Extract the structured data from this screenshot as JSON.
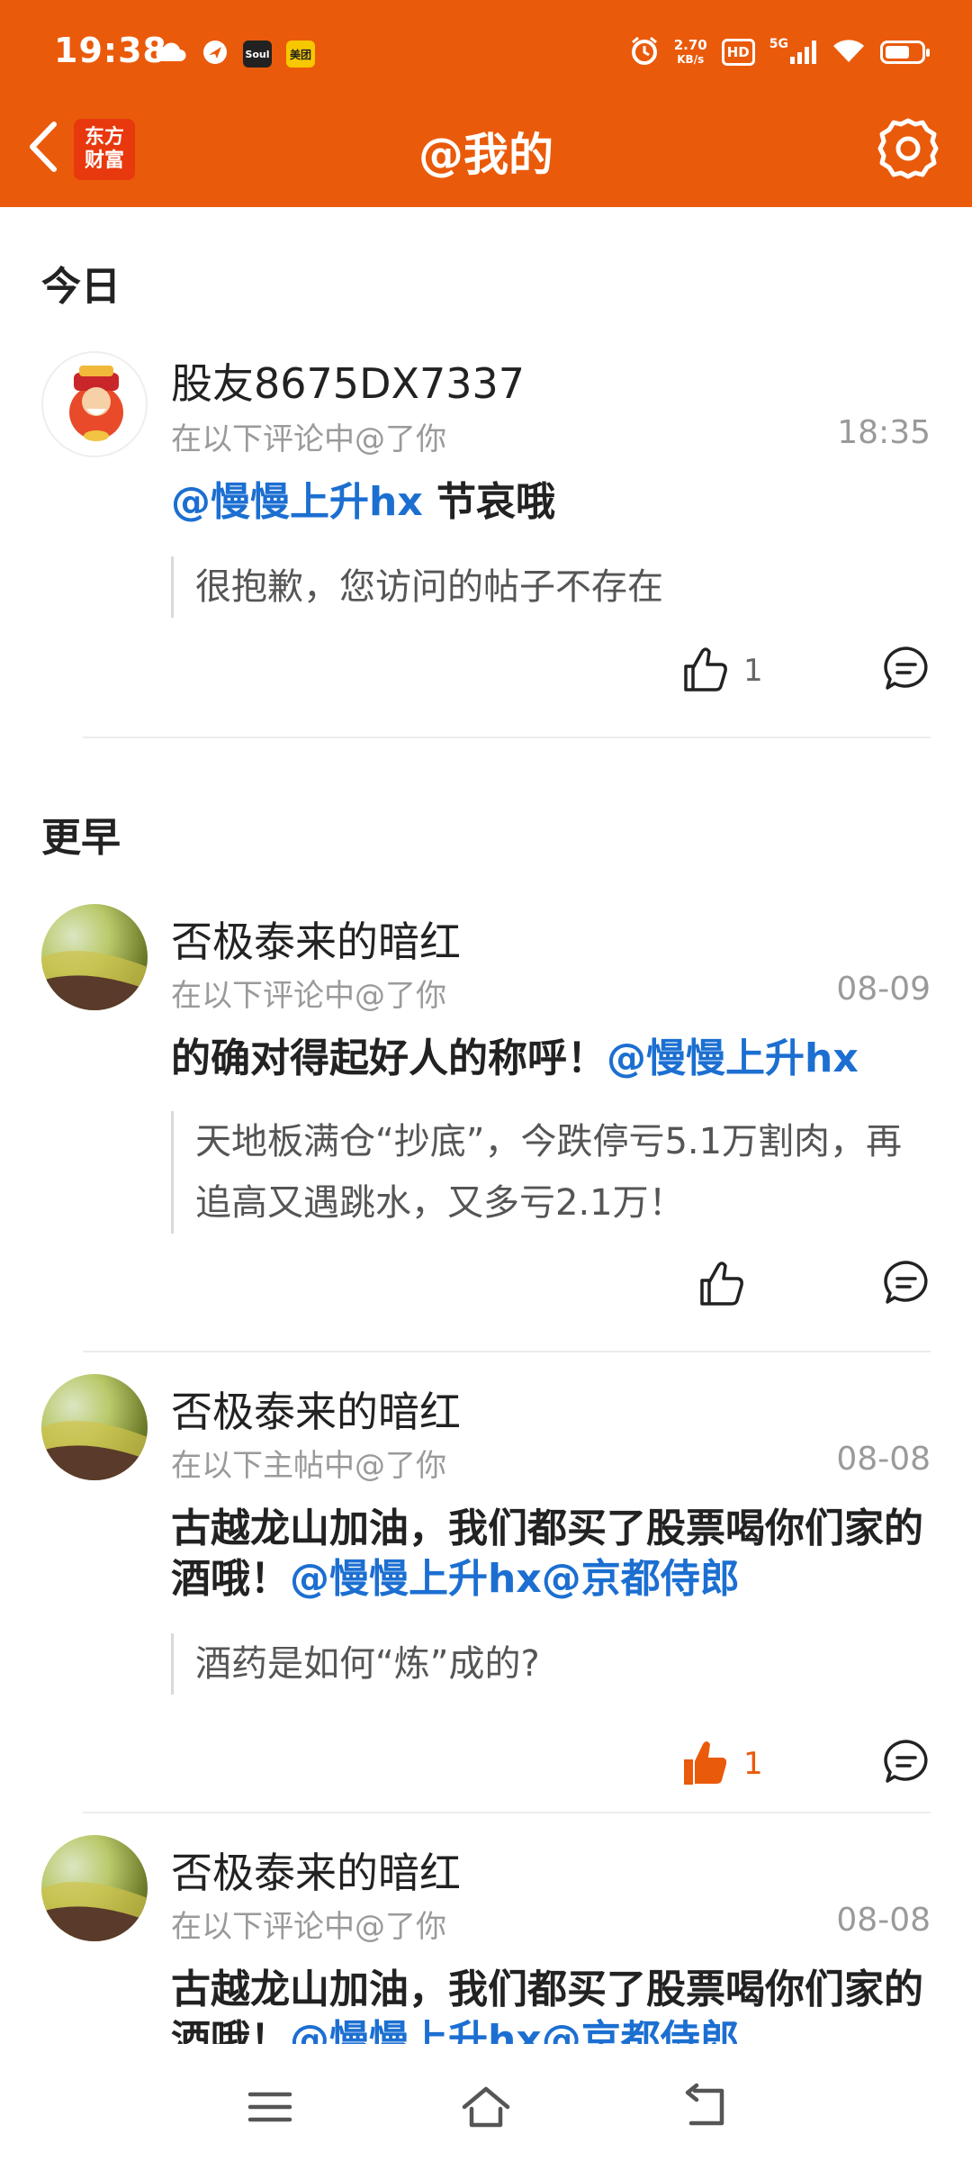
{
  "status_bar": {
    "time": "19:38",
    "net_speed_value": "2.70",
    "net_speed_unit": "KB/s",
    "hd": "HD",
    "signal": "5G",
    "app_icons": [
      "cloud-icon",
      "arrow-app-icon",
      "soul-icon",
      "meituan-icon"
    ],
    "soul_label": "Soul",
    "meituan_label": "美团"
  },
  "header": {
    "title": "@我的",
    "logo_line1": "东方",
    "logo_line2": "财富",
    "accent_color": "#ea5a0b"
  },
  "sections": {
    "today": "今日",
    "earlier": "更早"
  },
  "items": [
    {
      "username": "股友8675DX7337",
      "subtitle": "在以下评论中@了你",
      "time": "18:35",
      "content_mention": "@慢慢上升hx",
      "content_text": " 节哀哦",
      "quote": "很抱歉，您访问的帖子不存在",
      "likes": "1"
    },
    {
      "username": "否极泰来的暗红",
      "subtitle": "在以下评论中@了你",
      "time": "08-09",
      "content_text": "的确对得起好人的称呼！",
      "content_mention": "@慢慢上升hx",
      "quote": "天地板满仓“抄底”，今跌停亏5.1万割肉，再追高又遇跳水，又多亏2.1万！",
      "likes": ""
    },
    {
      "username": "否极泰来的暗红",
      "subtitle": "在以下主帖中@了你",
      "time": "08-08",
      "content_text": "古越龙山加油，我们都买了股票喝你们家的酒哦！",
      "content_mention": "@慢慢上升hx@京都侍郎",
      "quote": "酒药是如何“炼”成的?",
      "likes": "1"
    },
    {
      "username": "否极泰来的暗红",
      "subtitle": "在以下评论中@了你",
      "time": "08-08",
      "content_text": "古越龙山加油，我们都买了股票喝你们家的酒哦！",
      "content_mention": "@慢慢上升hx@京都侍郎"
    }
  ],
  "colors": {
    "mention": "#1c6fd1",
    "liked": "#ea5a0b"
  },
  "bottom_nav": [
    "menu-icon",
    "home-icon",
    "back-icon"
  ]
}
